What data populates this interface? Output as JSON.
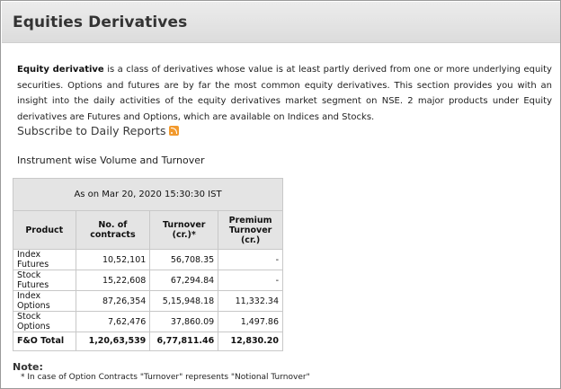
{
  "header": {
    "title": "Equities Derivatives"
  },
  "intro": {
    "term": "Equity derivative",
    "body": " is a class of derivatives whose value is at least partly derived from one or more underlying equity securities. Options and futures are by far the most common equity derivatives. This section provides you with an insight into the daily activities of the equity derivatives market segment on NSE. 2 major products under Equity derivatives are Futures and Options, which are available on Indices and Stocks."
  },
  "subscribe": {
    "label": "Subscribe to Daily Reports",
    "icon": "rss-icon"
  },
  "section_label": "Instrument wise Volume and Turnover",
  "table": {
    "as_of": "As on Mar 20, 2020 15:30:30 IST",
    "columns": [
      "Product",
      "No. of contracts",
      "Turnover (cr.)*",
      "Premium Turnover (cr.)"
    ],
    "rows": [
      {
        "product": "Index Futures",
        "contracts": "10,52,101",
        "turnover": "56,708.35",
        "premium": "-"
      },
      {
        "product": "Stock Futures",
        "contracts": "15,22,608",
        "turnover": "67,294.84",
        "premium": "-"
      },
      {
        "product": "Index Options",
        "contracts": "87,26,354",
        "turnover": "5,15,948.18",
        "premium": "11,332.34"
      },
      {
        "product": "Stock Options",
        "contracts": "7,62,476",
        "turnover": "37,860.09",
        "premium": "1,497.86"
      }
    ],
    "total": {
      "product": "F&O Total",
      "contracts": "1,20,63,539",
      "turnover": "6,77,811.46",
      "premium": "12,830.20"
    }
  },
  "note": {
    "title": "Note:",
    "text": "* In case of Option Contracts \"Turnover\" represents \"Notional Turnover\""
  }
}
